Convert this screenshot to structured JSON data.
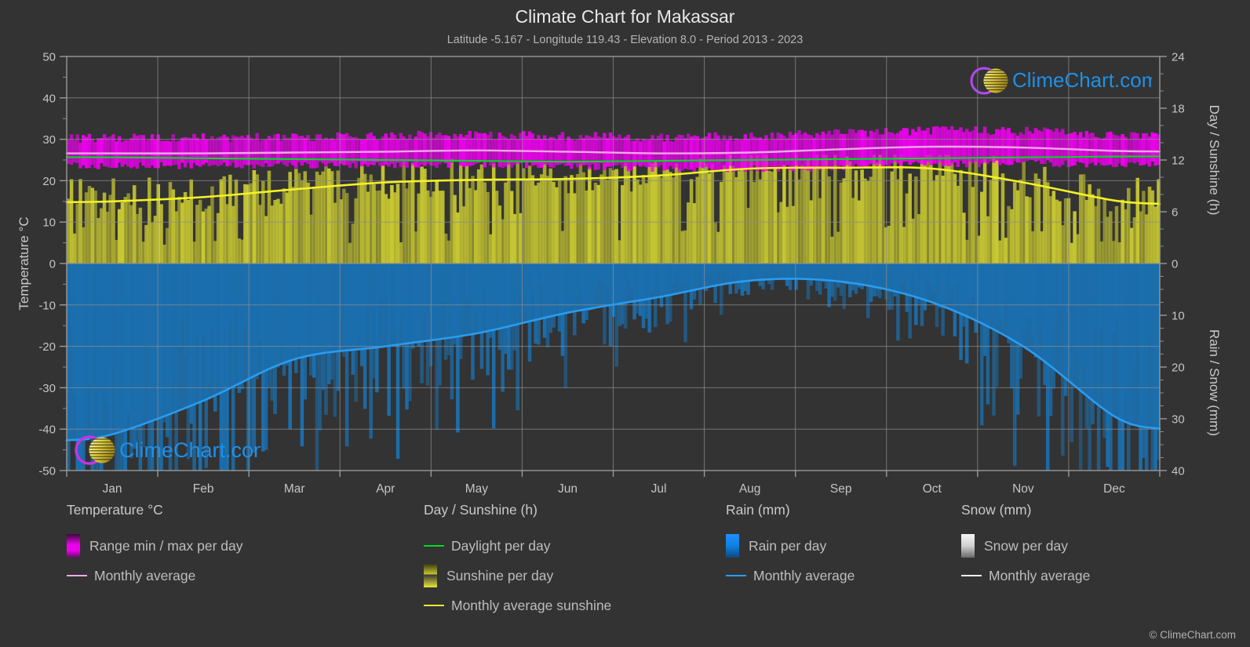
{
  "header": {
    "title": "Climate Chart for Makassar",
    "subtitle": "Latitude -5.167 - Longitude 119.43 - Elevation 8.0 - Period 2013 - 2023"
  },
  "watermark": {
    "text": "ClimeChart.com",
    "copyright": "© ClimeChart.com"
  },
  "axes": {
    "left_label": "Temperature °C",
    "right_top_label": "Day / Sunshine (h)",
    "right_bottom_label": "Rain / Snow (mm)",
    "left_ticks": [
      "50",
      "40",
      "30",
      "20",
      "10",
      "0",
      "-10",
      "-20",
      "-30",
      "-40",
      "-50"
    ],
    "right_top_ticks": [
      "24",
      "18",
      "12",
      "6",
      "0"
    ],
    "right_bottom_ticks": [
      "0",
      "10",
      "20",
      "30",
      "40"
    ],
    "months": [
      "Jan",
      "Feb",
      "Mar",
      "Apr",
      "May",
      "Jun",
      "Jul",
      "Aug",
      "Sep",
      "Oct",
      "Nov",
      "Dec"
    ]
  },
  "legend": {
    "columns": [
      {
        "title": "Temperature °C",
        "items": [
          {
            "label": "Range min / max per day",
            "kind": "box",
            "color": "#ee00ee"
          },
          {
            "label": "Monthly average",
            "kind": "line",
            "color": "#f0a8e8"
          }
        ]
      },
      {
        "title": "Day / Sunshine (h)",
        "items": [
          {
            "label": "Daylight per day",
            "kind": "line",
            "color": "#00d820"
          },
          {
            "label": "Sunshine per day",
            "kind": "box",
            "color": "#e8e832"
          },
          {
            "label": "Monthly average sunshine",
            "kind": "line",
            "color": "#e8e832"
          }
        ]
      },
      {
        "title": "Rain (mm)",
        "items": [
          {
            "label": "Rain per day",
            "kind": "box",
            "color": "#1080e0"
          },
          {
            "label": "Monthly average",
            "kind": "line",
            "color": "#2a9cf0"
          }
        ]
      },
      {
        "title": "Snow (mm)",
        "items": [
          {
            "label": "Snow per day",
            "kind": "box",
            "color": "#e0e0e0"
          },
          {
            "label": "Monthly average",
            "kind": "line",
            "color": "#f0f0f0"
          }
        ]
      }
    ]
  },
  "colors": {
    "background": "#333333",
    "grid": "#8c8c8c",
    "temp_range": "#ee00ee",
    "temp_avg": "#f0a8e8",
    "daylight": "#00d820",
    "sunshine": "#c8c832",
    "sunshine_avg": "#f2f226",
    "rain": "#1b6fae",
    "rain_avg": "#2a9cf0",
    "text": "#c4c4c4"
  },
  "chart_data": {
    "type": "line",
    "title": "Climate Chart for Makassar",
    "subtitle": "Latitude -5.167 - Longitude 119.43 - Elevation 8.0 - Period 2013 - 2023",
    "xlabel": "",
    "ylabel": "Temperature °C",
    "y2label_top": "Day / Sunshine (h)",
    "y2label_bottom": "Rain / Snow (mm)",
    "ylim": [
      -50,
      50
    ],
    "y2lim_top": [
      0,
      24
    ],
    "y2lim_bottom": [
      0,
      40
    ],
    "grid": true,
    "legend_position": "bottom",
    "categories": [
      "Jan",
      "Feb",
      "Mar",
      "Apr",
      "May",
      "Jun",
      "Jul",
      "Aug",
      "Sep",
      "Oct",
      "Nov",
      "Dec"
    ],
    "series": [
      {
        "name": "Monthly average temperature (°C)",
        "axis": "left",
        "color": "#f0a8e8",
        "values": [
          26.6,
          26.6,
          26.8,
          27.0,
          27.3,
          27.0,
          26.6,
          26.8,
          27.6,
          28.2,
          28.0,
          27.2
        ]
      },
      {
        "name": "Daily min temperature (°C)",
        "axis": "left",
        "color": "#ee00ee",
        "values": [
          23.6,
          23.6,
          23.7,
          23.8,
          24.0,
          23.5,
          22.9,
          22.8,
          23.2,
          24.0,
          24.2,
          23.9
        ]
      },
      {
        "name": "Daily max temperature (°C)",
        "axis": "left",
        "color": "#ee00ee",
        "values": [
          30.2,
          30.2,
          30.5,
          30.8,
          31.0,
          30.6,
          30.3,
          30.6,
          31.4,
          32.0,
          31.8,
          30.9
        ]
      },
      {
        "name": "Daylight per day (h)",
        "axis": "right_top",
        "color": "#00d820",
        "values": [
          12.3,
          12.2,
          12.1,
          12.0,
          11.9,
          11.8,
          11.9,
          12.0,
          12.1,
          12.2,
          12.3,
          12.4
        ]
      },
      {
        "name": "Monthly average sunshine (h)",
        "axis": "right_top",
        "color": "#f2f226",
        "values": [
          7.2,
          7.7,
          8.6,
          9.4,
          9.7,
          9.8,
          10.2,
          11.0,
          11.1,
          11.0,
          9.4,
          7.3
        ]
      },
      {
        "name": "Monthly average rain (mm)",
        "axis": "right_bottom",
        "color": "#2a9cf0",
        "values": [
          33.0,
          26.5,
          18.5,
          16.0,
          13.5,
          9.5,
          6.5,
          3.3,
          3.5,
          7.5,
          16.0,
          29.5
        ]
      }
    ],
    "notes": "Stacked dual-panel climate chart: upper panel shows temperature range band (magenta) with sunshine hours (yellow) measured on the right axis; lower panel shows daily rain (blue) plotted downward from zero."
  }
}
